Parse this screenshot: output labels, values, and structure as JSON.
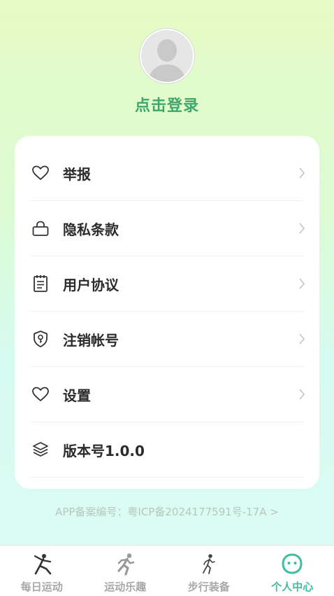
{
  "profile": {
    "login_label": "点击登录"
  },
  "menu": {
    "items": [
      {
        "label": "举报",
        "icon": "heart-icon"
      },
      {
        "label": "隐私条款",
        "icon": "lock-icon"
      },
      {
        "label": "用户协议",
        "icon": "notepad-icon"
      },
      {
        "label": "注销帐号",
        "icon": "shield-key-icon"
      },
      {
        "label": "设置",
        "icon": "heart-icon"
      },
      {
        "label": "版本号1.0.0",
        "icon": "layers-icon"
      }
    ]
  },
  "footer": {
    "icp_text": "APP备案编号：粤ICP备2024177591号-17A >"
  },
  "tabbar": {
    "tabs": [
      {
        "label": "每日运动",
        "icon": "stretching-person-icon"
      },
      {
        "label": "运动乐趣",
        "icon": "running-person-icon"
      },
      {
        "label": "步行装备",
        "icon": "walking-person-icon"
      },
      {
        "label": "个人中心",
        "icon": "smiley-face-icon",
        "active": true
      }
    ]
  },
  "colors": {
    "accent": "#3cbfa0",
    "login_green": "#3fa66c",
    "inactive_tab": "#a8a8a8"
  }
}
